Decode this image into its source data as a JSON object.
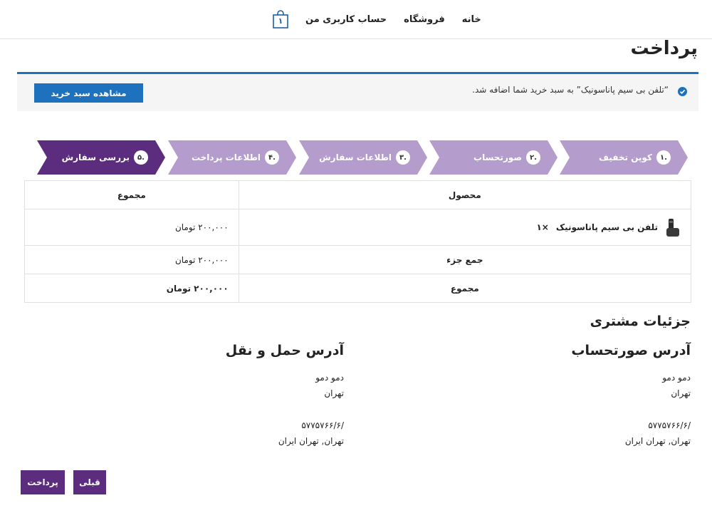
{
  "nav": {
    "cart_count": "۱",
    "my_account": "حساب کاربری من",
    "shop": "فروشگاه",
    "home": "خانه"
  },
  "page_title": "پرداخت",
  "notice": {
    "text": "“تلفن بی سیم پاناسونیک” به سبد خرید شما اضافه شد.",
    "view_cart": "مشاهده سبد خرید",
    "accent_color": "#1e72bd"
  },
  "steps": [
    {
      "num": "۱.",
      "label": "کوپن تخفیف",
      "active": false
    },
    {
      "num": "۲.",
      "label": "صورتحساب",
      "active": false
    },
    {
      "num": "۳.",
      "label": "اطلاعات سفارش",
      "active": false
    },
    {
      "num": "۴.",
      "label": "اطلاعات پرداخت",
      "active": false
    },
    {
      "num": "۵.",
      "label": "بررسی سفارش",
      "active": true
    }
  ],
  "step_colors": {
    "inactive": "#b49ccc",
    "active": "#5c2d7e"
  },
  "order": {
    "col_product": "محصول",
    "col_total": "مجموع",
    "item_name": "تلفن بی سیم پاناسونیک",
    "item_qty": "×۱",
    "item_total": "۲۰۰,۰۰۰ تومان",
    "subtotal_label": "جمع جزء",
    "subtotal_value": "۲۰۰,۰۰۰ تومان",
    "total_label": "مجموع",
    "total_value": "۲۰۰,۰۰۰ تومان"
  },
  "customer": {
    "heading": "جزئیات مشتری",
    "billing": {
      "heading": "آدرس صورتحساب",
      "name": "دمو دمو",
      "city": "تهران",
      "phone": "/۵۷۷۵۷۶۶/۶",
      "region": "تهران, تهران ایران"
    },
    "shipping": {
      "heading": "آدرس حمل و نقل",
      "name": "دمو دمو",
      "city": "تهران",
      "phone": "/۵۷۷۵۷۶۶/۶",
      "region": "تهران, تهران ایران"
    }
  },
  "buttons": {
    "prev": "قبلی",
    "pay": "پرداخت",
    "color": "#5c2d7e"
  }
}
